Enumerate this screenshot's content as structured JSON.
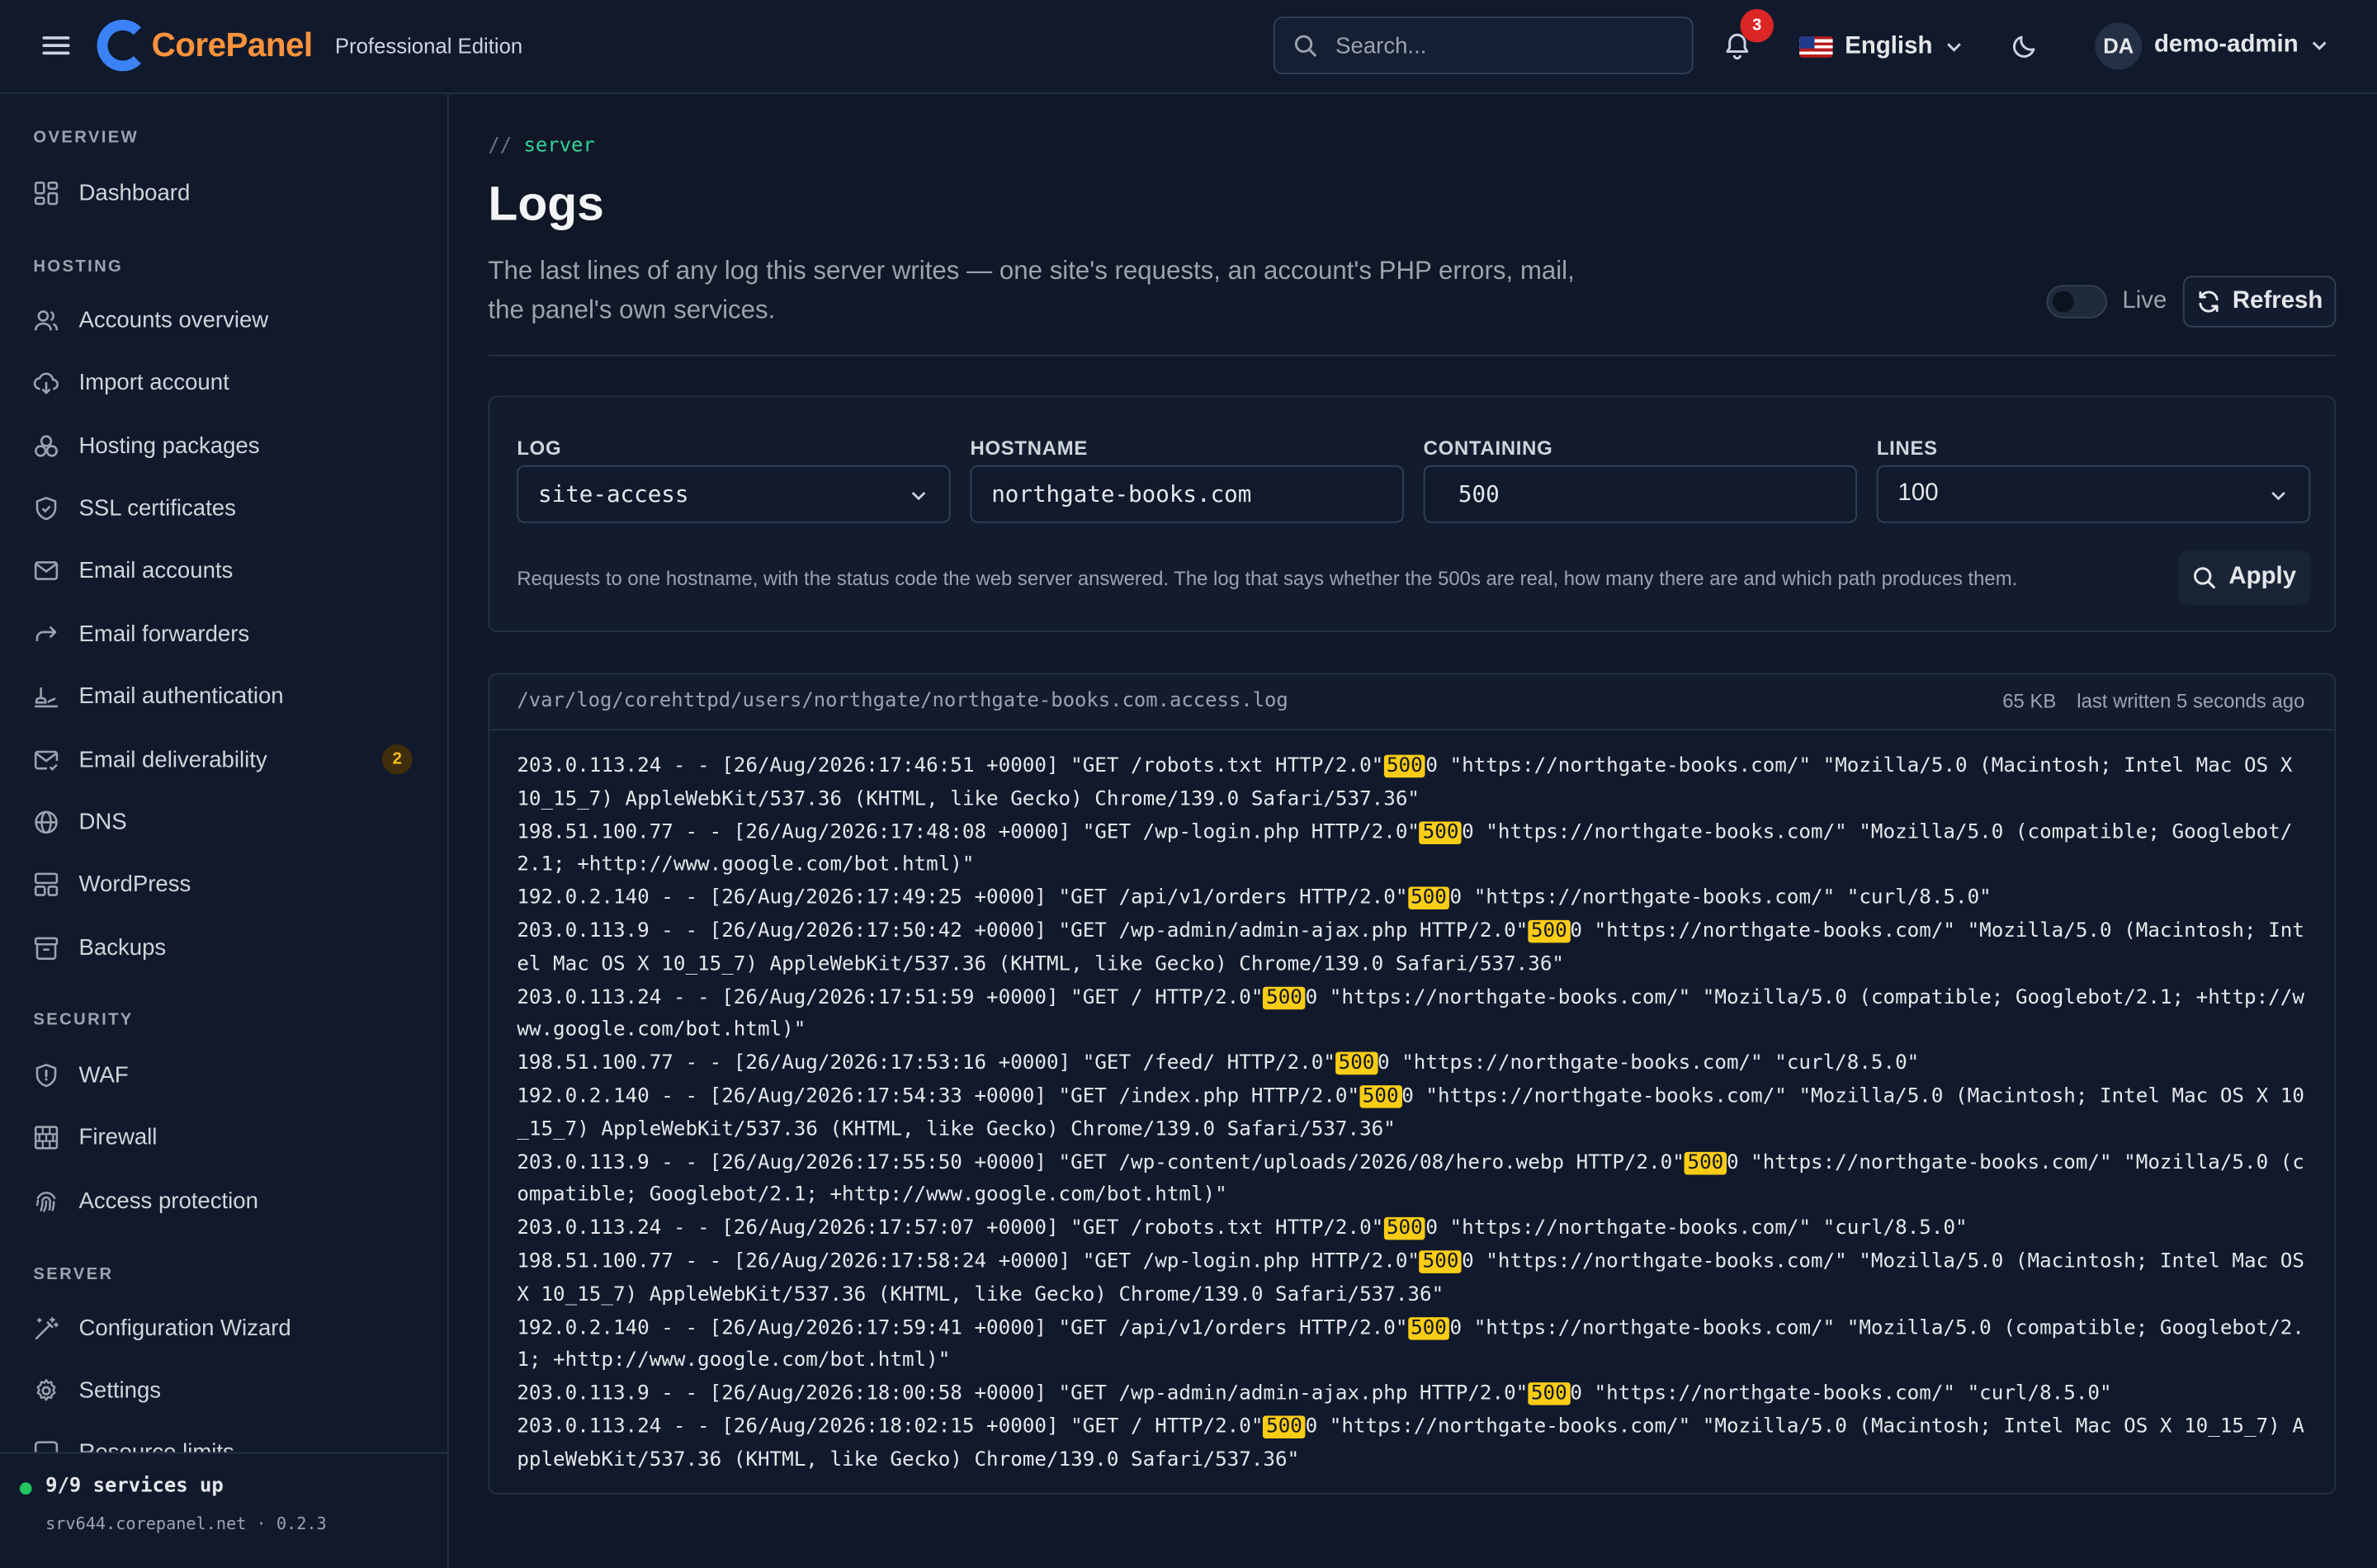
{
  "header": {
    "brand": "CorePanel",
    "edition": "Professional Edition",
    "search_placeholder": "Search...",
    "notifications_count": "3",
    "language": "English",
    "user_initials": "DA",
    "username": "demo-admin"
  },
  "sidebar": {
    "sections": {
      "overview": "OVERVIEW",
      "hosting": "HOSTING",
      "security": "SECURITY",
      "server": "SERVER"
    },
    "items": {
      "dashboard": "Dashboard",
      "accounts_overview": "Accounts overview",
      "import_account": "Import account",
      "hosting_packages": "Hosting packages",
      "ssl_certificates": "SSL certificates",
      "email_accounts": "Email accounts",
      "email_forwarders": "Email forwarders",
      "email_authentication": "Email authentication",
      "email_deliverability": "Email deliverability",
      "email_deliverability_badge": "2",
      "dns": "DNS",
      "wordpress": "WordPress",
      "backups": "Backups",
      "waf": "WAF",
      "firewall": "Firewall",
      "access_protection": "Access protection",
      "configuration_wizard": "Configuration Wizard",
      "settings": "Settings",
      "resource_limits": "Resource limits"
    },
    "footer": {
      "services_status": "9/9 services up",
      "host_version": "srv644.corepanel.net · 0.2.3"
    }
  },
  "page": {
    "breadcrumb_prefix": "//",
    "breadcrumb": "server",
    "title": "Logs",
    "description": "The last lines of any log this server writes — one site's requests, an account's PHP errors, mail, the panel's own services.",
    "live_label": "Live",
    "refresh_label": "Refresh"
  },
  "filters": {
    "log_label": "LOG",
    "log_value": "site-access",
    "hostname_label": "HOSTNAME",
    "hostname_value": "northgate-books.com",
    "containing_label": "CONTAINING",
    "containing_value": "500",
    "lines_label": "LINES",
    "lines_value": "100",
    "help": "Requests to one hostname, with the status code the web server answered. The log that says whether the 500s are real, how many there are and which path produces them.",
    "apply_label": "Apply"
  },
  "log": {
    "path": "/var/log/corehttpd/users/northgate/northgate-books.com.access.log",
    "size": "65 KB",
    "last_written": "last written 5 seconds ago",
    "highlight": "500",
    "lines": [
      {
        "pre": "203.0.113.24 - - [26/Aug/2026:17:46:51 +0000] \"GET /robots.txt HTTP/2.0\" ",
        "code": "500",
        "post": "0 \"https://northgate-books.com/\" \"Mozilla/5.0 (Macintosh; Intel Mac OS X 10_15_7) AppleWebKit/537.36 (KHTML, like Gecko) Chrome/139.0 Safari/537.36\""
      },
      {
        "pre": "198.51.100.77 - - [26/Aug/2026:17:48:08 +0000] \"GET /wp-login.php HTTP/2.0\" ",
        "code": "500",
        "post": "0 \"https://northgate-books.com/\" \"Mozilla/5.0 (compatible; Googlebot/2.1; +http://www.google.com/bot.html)\""
      },
      {
        "pre": "192.0.2.140 - - [26/Aug/2026:17:49:25 +0000] \"GET /api/v1/orders HTTP/2.0\" ",
        "code": "500",
        "post": "0 \"https://northgate-books.com/\" \"curl/8.5.0\""
      },
      {
        "pre": "203.0.113.9 - - [26/Aug/2026:17:50:42 +0000] \"GET /wp-admin/admin-ajax.php HTTP/2.0\" ",
        "code": "500",
        "post": "0 \"https://northgate-books.com/\" \"Mozilla/5.0 (Macintosh; Intel Mac OS X 10_15_7) AppleWebKit/537.36 (KHTML, like Gecko) Chrome/139.0 Safari/537.36\""
      },
      {
        "pre": "203.0.113.24 - - [26/Aug/2026:17:51:59 +0000] \"GET / HTTP/2.0\" ",
        "code": "500",
        "post": "0 \"https://northgate-books.com/\" \"Mozilla/5.0 (compatible; Googlebot/2.1; +http://www.google.com/bot.html)\""
      },
      {
        "pre": "198.51.100.77 - - [26/Aug/2026:17:53:16 +0000] \"GET /feed/ HTTP/2.0\" ",
        "code": "500",
        "post": "0 \"https://northgate-books.com/\" \"curl/8.5.0\""
      },
      {
        "pre": "192.0.2.140 - - [26/Aug/2026:17:54:33 +0000] \"GET /index.php HTTP/2.0\" ",
        "code": "500",
        "post": "0 \"https://northgate-books.com/\" \"Mozilla/5.0 (Macintosh; Intel Mac OS X 10_15_7) AppleWebKit/537.36 (KHTML, like Gecko) Chrome/139.0 Safari/537.36\""
      },
      {
        "pre": "203.0.113.9 - - [26/Aug/2026:17:55:50 +0000] \"GET /wp-content/uploads/2026/08/hero.webp HTTP/2.0\" ",
        "code": "500",
        "post": "0 \"https://northgate-books.com/\" \"Mozilla/5.0 (compatible; Googlebot/2.1; +http://www.google.com/bot.html)\""
      },
      {
        "pre": "203.0.113.24 - - [26/Aug/2026:17:57:07 +0000] \"GET /robots.txt HTTP/2.0\" ",
        "code": "500",
        "post": "0 \"https://northgate-books.com/\" \"curl/8.5.0\""
      },
      {
        "pre": "198.51.100.77 - - [26/Aug/2026:17:58:24 +0000] \"GET /wp-login.php HTTP/2.0\" ",
        "code": "500",
        "post": "0 \"https://northgate-books.com/\" \"Mozilla/5.0 (Macintosh; Intel Mac OS X 10_15_7) AppleWebKit/537.36 (KHTML, like Gecko) Chrome/139.0 Safari/537.36\""
      },
      {
        "pre": "192.0.2.140 - - [26/Aug/2026:17:59:41 +0000] \"GET /api/v1/orders HTTP/2.0\" ",
        "code": "500",
        "post": "0 \"https://northgate-books.com/\" \"Mozilla/5.0 (compatible; Googlebot/2.1; +http://www.google.com/bot.html)\""
      },
      {
        "pre": "203.0.113.9 - - [26/Aug/2026:18:00:58 +0000] \"GET /wp-admin/admin-ajax.php HTTP/2.0\" ",
        "code": "500",
        "post": "0 \"https://northgate-books.com/\" \"curl/8.5.0\""
      },
      {
        "pre": "203.0.113.24 - - [26/Aug/2026:18:02:15 +0000] \"GET / HTTP/2.0\" ",
        "code": "500",
        "post": "0 \"https://northgate-books.com/\" \"Mozilla/5.0 (Macintosh; Intel Mac OS X 10_15_7) AppleWebKit/537.36 (KHTML, like Gecko) Chrome/139.0 Safari/537.36\""
      }
    ]
  },
  "colors": {
    "background": "#101828",
    "accent_green": "#34d399",
    "highlight": "#facc15",
    "badge_red": "#dc2626",
    "logo_blue": "#3b82f6",
    "logo_orange": "#fb923c"
  }
}
